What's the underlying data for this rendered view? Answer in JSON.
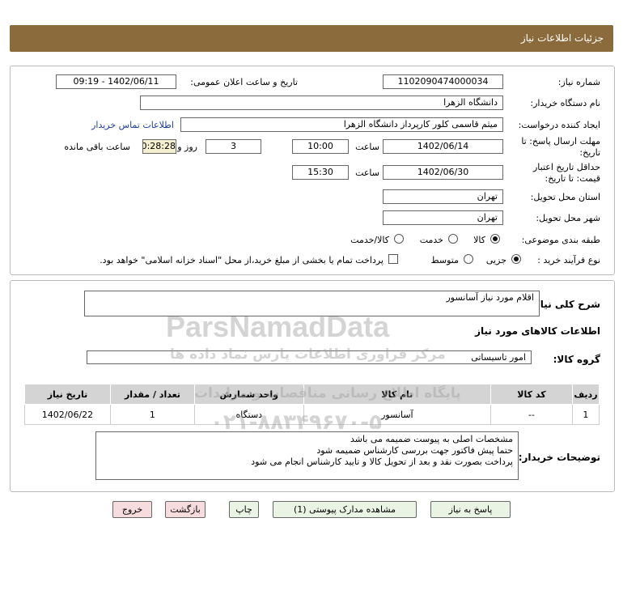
{
  "header": {
    "title": "جزئیات اطلاعات نیاز"
  },
  "form": {
    "need_number_label": "شماره نیاز:",
    "need_number": "1102090474000034",
    "announce_label": "تاریخ و ساعت اعلان عمومی:",
    "announce_value": "1402/06/11 - 09:19",
    "buyer_org_label": "نام دستگاه خریدار:",
    "buyer_org": "دانشگاه الزهرا",
    "creator_label": "ایجاد کننده درخواست:",
    "creator": "میثم  قاسمی کلور کارپرداز دانشگاه الزهرا",
    "contact_link": "اطلاعات تماس خریدار",
    "deadline_label_1": "مهلت ارسال پاسخ: تا",
    "deadline_label_2": "تاریخ:",
    "deadline_date": "1402/06/14",
    "time_label": "ساعت",
    "deadline_time": "10:00",
    "days": "3",
    "days_label": "روز و",
    "remaining": "00:28:28",
    "remaining_label": "ساعت باقی مانده",
    "validity_label_1": "حداقل تاریخ اعتبار",
    "validity_label_2": "قیمت: تا تاریخ:",
    "validity_date": "1402/06/30",
    "validity_time": "15:30",
    "province_label": "استان محل تحویل:",
    "province": "تهران",
    "city_label": "شهر محل تحویل:",
    "city": "تهران",
    "category_label": "طبقه بندی موضوعی:",
    "category_options": [
      "کالا",
      "خدمت",
      "کالا/خدمت"
    ],
    "process_label": "نوع فرآیند خرید :",
    "process_options": [
      "جزیی",
      "متوسط"
    ],
    "payment_note": "پرداخت تمام یا بخشی از مبلغ خرید،از محل \"اسناد خزانه اسلامی\" خواهد بود."
  },
  "details": {
    "summary_label": "شرح کلی نیاز:",
    "summary": "اقلام مورد نیاز آسانسور",
    "goods_info_title": "اطلاعات کالاهای مورد نیاز",
    "goods_group_label": "گروه کالا:",
    "goods_group": "امور تاسیساتی",
    "table": {
      "headers": [
        "ردیف",
        "کد کالا",
        "نام کالا",
        "واحد شمارش",
        "تعداد / مقدار",
        "تاریخ نیاز"
      ],
      "rows": [
        [
          "1",
          "--",
          "آسانسور",
          "دستگاه",
          "1",
          "1402/06/22"
        ]
      ]
    },
    "buyer_notes_label": "توضیحات خریدار:",
    "buyer_notes": [
      "مشخصات اصلی به پیوست ضمیمه می باشد",
      "حتما پیش فاکتور جهت بررسی کارشناس ضمیمه شود",
      "پرداخت بصورت نقد و بعد از تحویل کالا و تایید کارشناس انجام می شود"
    ]
  },
  "buttons": {
    "reply": "پاسخ به نیاز",
    "attachments": "مشاهده مدارک پیوستی (1)",
    "print": "چاپ",
    "back": "بازگشت",
    "exit": "خروج"
  },
  "watermark": {
    "line1": "ParsNamadData",
    "line2": "مرکز فراوری اطلاعات پارس نماد داده ها",
    "line3": "پایگاه اطلاع رسانی مناقصات و مزایدات",
    "line4": "۰۲۱-۸۸۳۴۹۶۷۰-۵"
  }
}
